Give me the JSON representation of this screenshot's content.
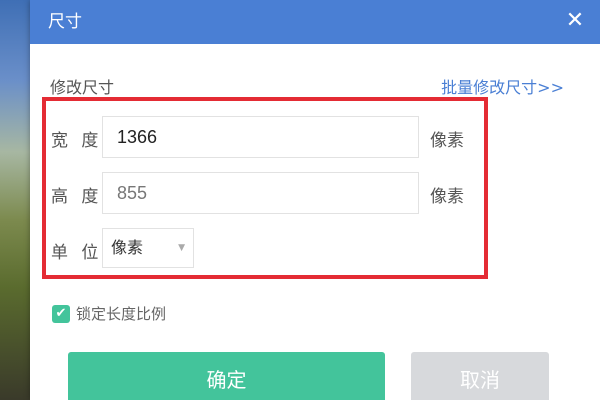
{
  "dialog": {
    "title": "尺寸",
    "close_symbol": "✕",
    "section_label": "修改尺寸",
    "batch_link": "批量修改尺寸>>",
    "width_label": "宽 度",
    "width_value": "1366",
    "width_unit": "像素",
    "height_label": "高 度",
    "height_value": "855",
    "height_unit": "像素",
    "unit_label": "单 位",
    "unit_selected": "像素",
    "lock_ratio_label": "锁定长度比例",
    "lock_ratio_checked": true,
    "ok_label": "确定",
    "cancel_label": "取消"
  },
  "colors": {
    "titlebar": "#4a7fd4",
    "accent_green": "#43c49b",
    "highlight_red": "#e42b34",
    "cancel_gray": "#d7d9dc"
  },
  "icons": {
    "close": "close-icon",
    "checkbox": "checkmark-icon",
    "dropdown": "chevron-down-icon"
  }
}
